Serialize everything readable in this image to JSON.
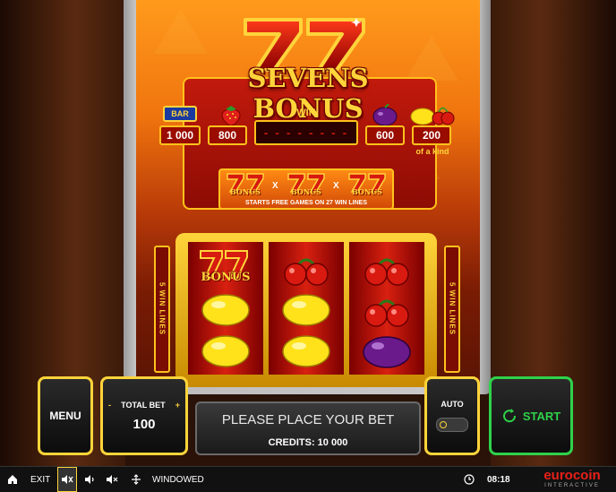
{
  "game": {
    "title": "SEVENS BONUS"
  },
  "paytable": {
    "bar_label": "BAR",
    "values": [
      "1 000",
      "800",
      "600",
      "200"
    ],
    "win_label": "WIN",
    "win_value": "- - - - - - - -",
    "of_a_kind": "of a kind",
    "bonus_word": "BONUS",
    "x_sign": "X",
    "bonus_note": "STARTS FREE GAMES ON 27 WIN LINES"
  },
  "side_plates": {
    "left": "5 WIN LINES",
    "right": "5 WIN LINES"
  },
  "reels": [
    [
      "sevens-bonus",
      "lemon",
      "lemon"
    ],
    [
      "cherry",
      "lemon",
      "lemon"
    ],
    [
      "cherry",
      "cherry",
      "plum"
    ]
  ],
  "controls": {
    "menu_label": "MENU",
    "total_bet_label": "TOTAL BET",
    "minus": "-",
    "plus": "+",
    "total_bet_value": "100",
    "message": "PLEASE PLACE YOUR BET",
    "credits_label": "CREDITS: 10 000",
    "auto_label": "AUTO",
    "start_label": "START"
  },
  "bottom_bar": {
    "exit_label": "EXIT",
    "windowed_label": "WINDOWED",
    "time": "08:18",
    "brand": "eurocoin",
    "brand_sub": "INTERACTIVE"
  },
  "colors": {
    "gold": "#ffd43a",
    "red": "#c21a0c",
    "start_green": "#2ed24a"
  },
  "icons": [
    "home-icon",
    "turbo-icon",
    "volume-icon",
    "mute-icon",
    "fullscreen-icon",
    "clock-icon",
    "refresh-icon",
    "toggle-icon"
  ]
}
